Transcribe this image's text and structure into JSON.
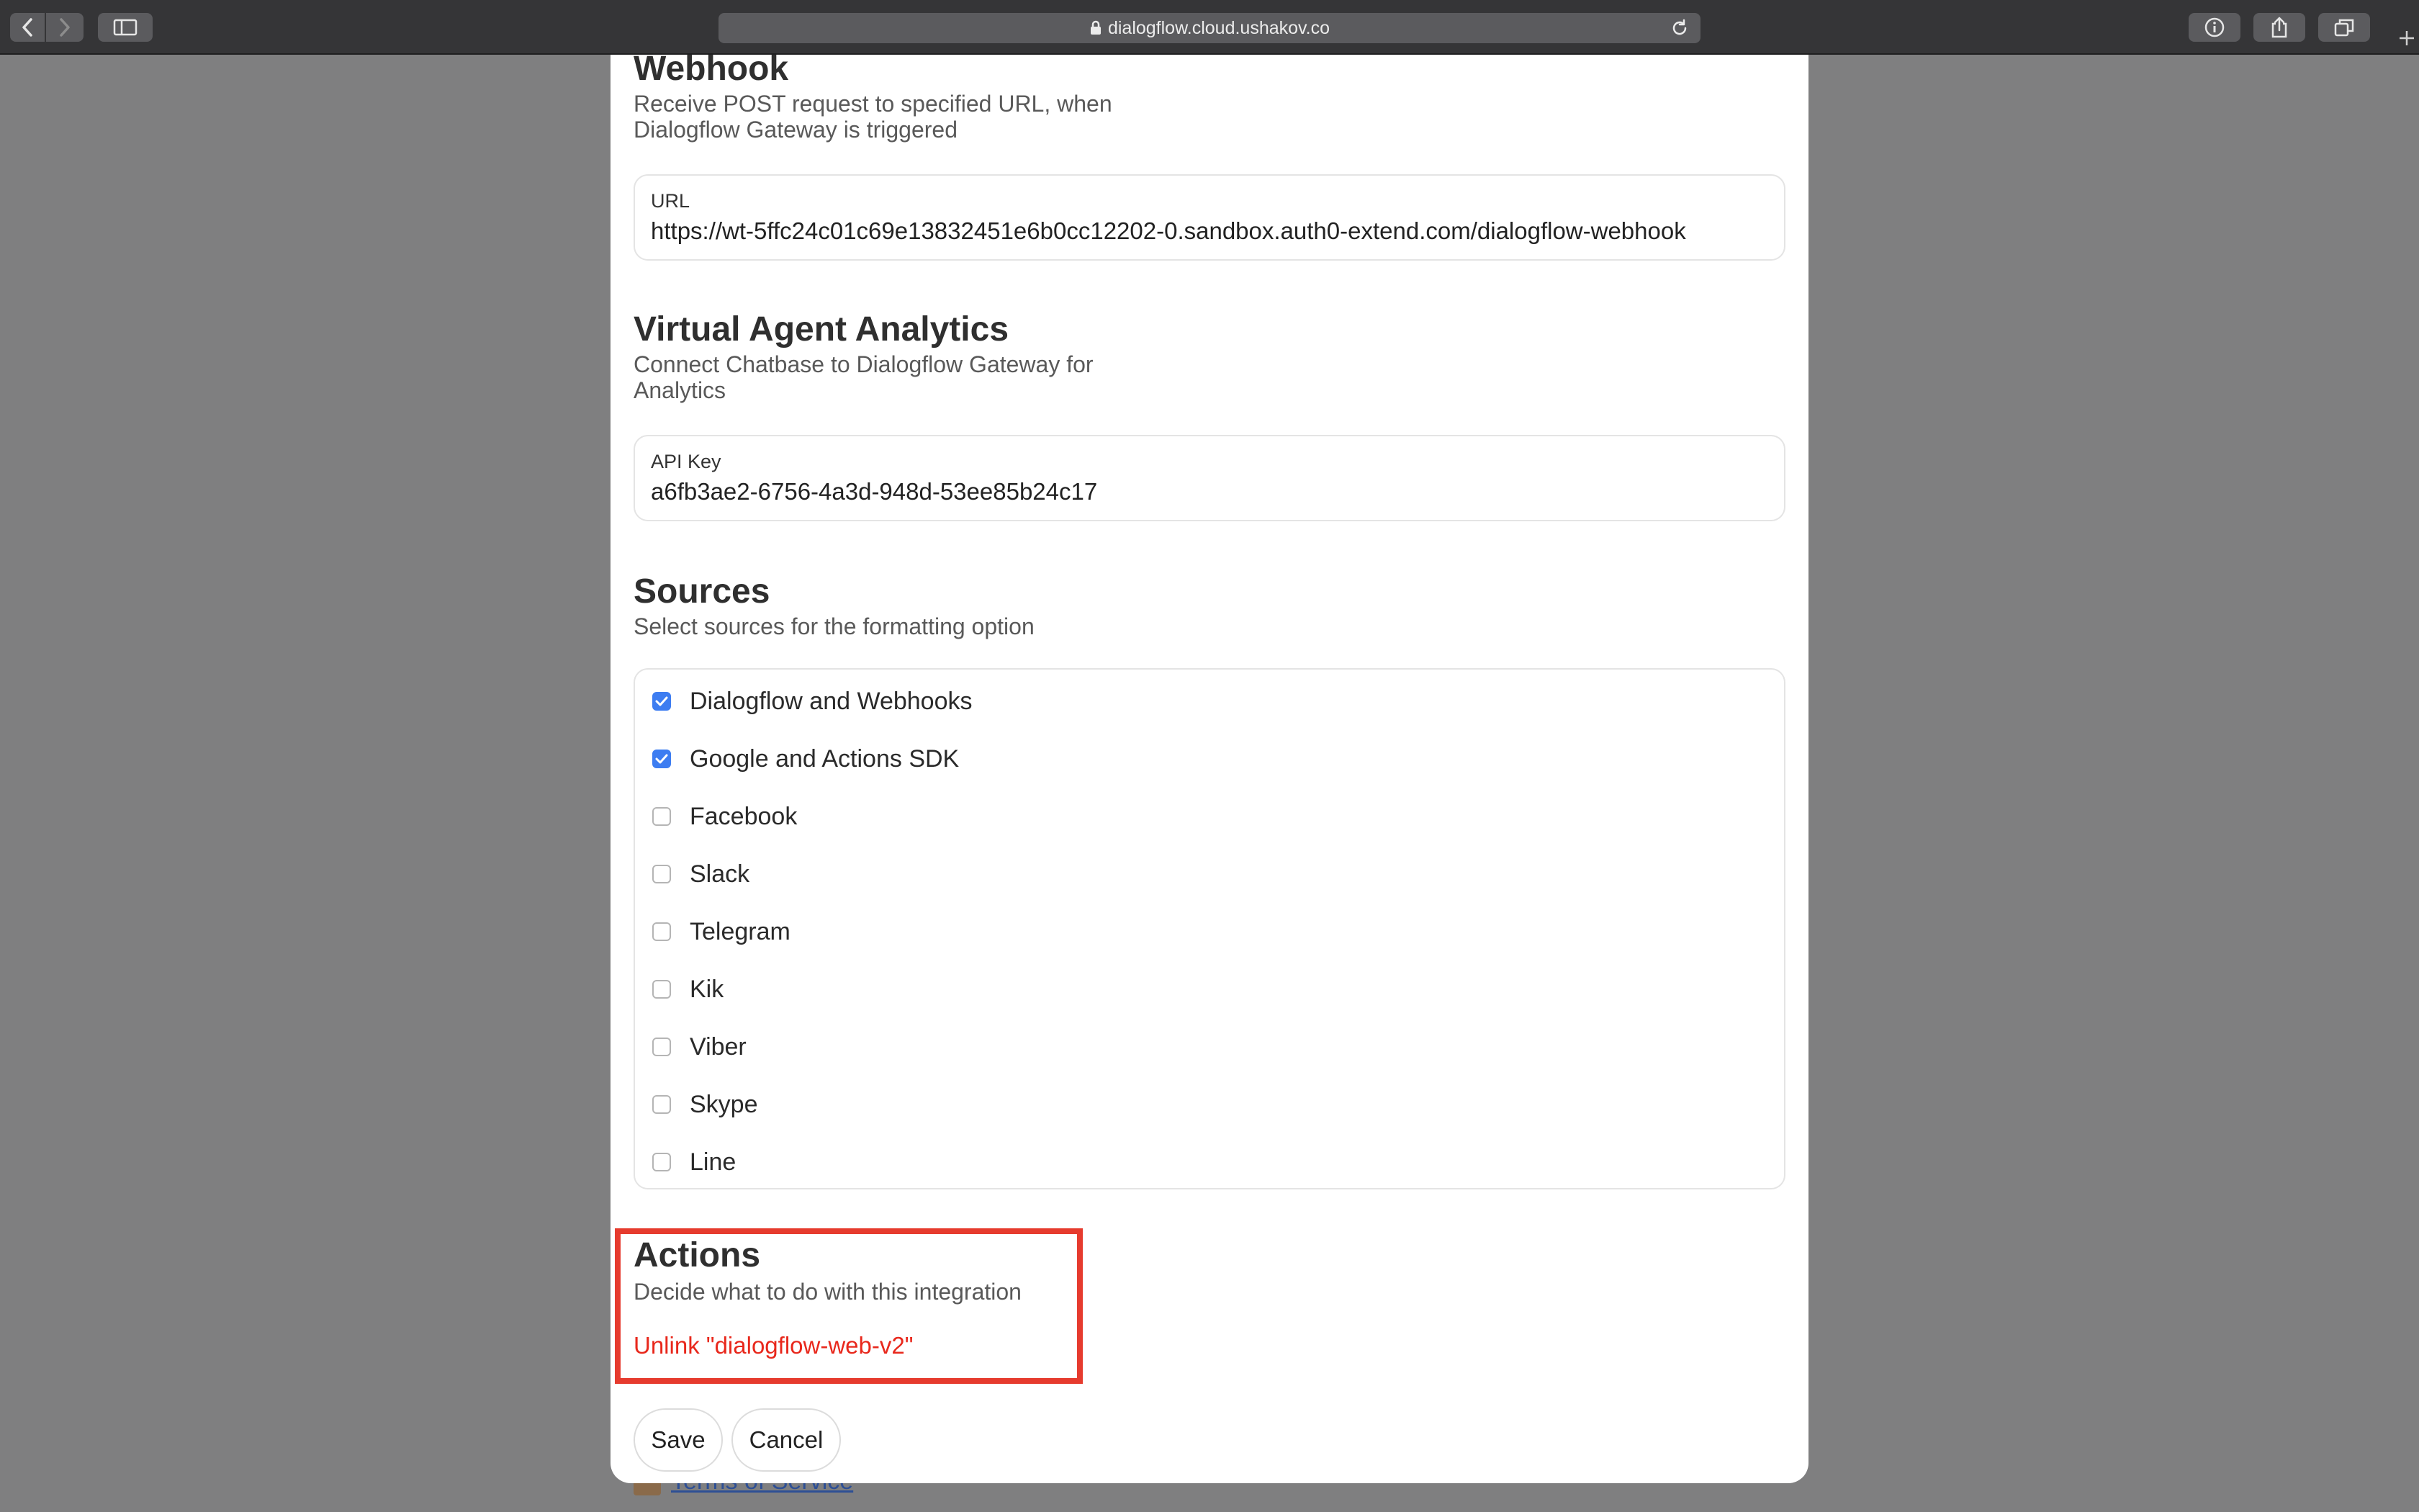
{
  "browser": {
    "url": "dialogflow.cloud.ushakov.co"
  },
  "footer": {
    "link_label": "Terms of Service"
  },
  "webhook": {
    "title": "Webhook",
    "description": "Receive POST request to specified URL, when Dialogflow Gateway is triggered",
    "url_label": "URL",
    "url_value": "https://wt-5ffc24c01c69e13832451e6b0cc12202-0.sandbox.auth0-extend.com/dialogflow-webhook"
  },
  "analytics": {
    "title": "Virtual Agent Analytics",
    "description": "Connect Chatbase to Dialogflow Gateway for Analytics",
    "api_key_label": "API Key",
    "api_key_value": "a6fb3ae2-6756-4a3d-948d-53ee85b24c17"
  },
  "sources": {
    "title": "Sources",
    "description": "Select sources for the formatting option",
    "items": [
      {
        "label": "Dialogflow and Webhooks",
        "checked": true
      },
      {
        "label": "Google and Actions SDK",
        "checked": true
      },
      {
        "label": "Facebook",
        "checked": false
      },
      {
        "label": "Slack",
        "checked": false
      },
      {
        "label": "Telegram",
        "checked": false
      },
      {
        "label": "Kik",
        "checked": false
      },
      {
        "label": "Viber",
        "checked": false
      },
      {
        "label": "Skype",
        "checked": false
      },
      {
        "label": "Line",
        "checked": false
      }
    ]
  },
  "actions": {
    "title": "Actions",
    "description": "Decide what to do with this integration",
    "unlink_label": "Unlink \"dialogflow-web-v2\""
  },
  "buttons": {
    "save": "Save",
    "cancel": "Cancel"
  },
  "colors": {
    "accent_checkbox": "#3d7df1",
    "danger_link": "#e8281c",
    "highlight_border": "#e63b2e"
  }
}
